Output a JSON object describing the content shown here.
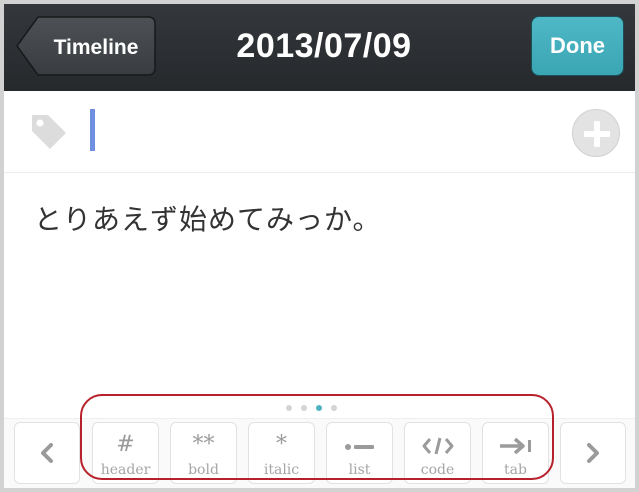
{
  "navbar": {
    "back_label": "Timeline",
    "title": "2013/07/09",
    "done_label": "Done"
  },
  "tags": {
    "tag_icon": "tag-icon",
    "input_value": "",
    "add_icon": "plus-circle-icon"
  },
  "editor": {
    "text": "とりあえず始めてみっか。"
  },
  "toolbar": {
    "prev_icon": "chevron-left-icon",
    "next_icon": "chevron-right-icon",
    "page_count": 4,
    "active_page": 3,
    "buttons": [
      {
        "glyph": "#",
        "label": "header"
      },
      {
        "glyph": "**",
        "label": "bold"
      },
      {
        "glyph": "*",
        "label": "italic"
      },
      {
        "glyph": "list-icon",
        "label": "list"
      },
      {
        "glyph": "code-icon",
        "label": "code"
      },
      {
        "glyph": "tab-icon",
        "label": "tab"
      }
    ]
  },
  "colors": {
    "navbar": "#2a2d31",
    "done_button": "#45aebc",
    "cursor": "#6f8fe0",
    "active_dot": "#4fb1c0",
    "highlight": "#b8202b"
  }
}
